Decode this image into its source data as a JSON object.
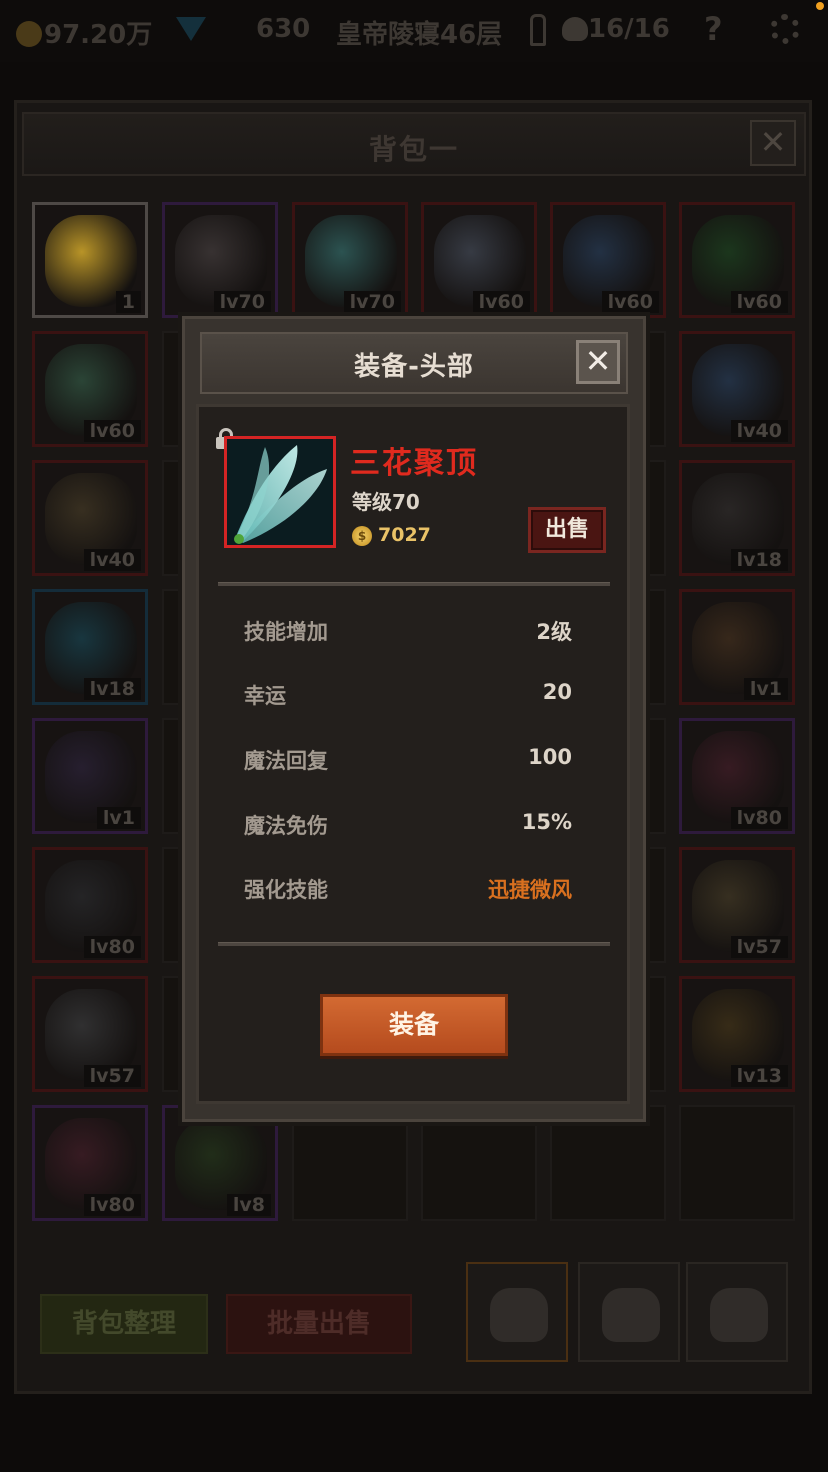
{
  "topbar": {
    "gold": "97.20万",
    "gems": "630",
    "location": "皇帝陵寝46层",
    "keys_progress": "16/16",
    "help": "?"
  },
  "backpack": {
    "title": "背包一",
    "close_symbol": "✕",
    "slots": [
      {
        "level": "1",
        "icon": "cheese-icon",
        "color": "#caa22a"
      },
      {
        "level": "lv70",
        "icon": "pistol-icon",
        "color": "#3b3535"
      },
      {
        "level": "lv70",
        "icon": "feather-blades-icon",
        "color": "#2e5a58"
      },
      {
        "level": "lv60",
        "icon": "double-axe-icon",
        "color": "#3a3f49"
      },
      {
        "level": "lv60",
        "icon": "sword-icon",
        "color": "#243449"
      },
      {
        "level": "lv60",
        "icon": "green-orb-necklace-icon",
        "color": "#1c3a1e"
      },
      {
        "level": "lv60",
        "icon": "green-ring-icon",
        "color": "#2d4a3a"
      },
      {
        "level": "",
        "icon": "",
        "color": ""
      },
      {
        "level": "",
        "icon": "",
        "color": ""
      },
      {
        "level": "",
        "icon": "",
        "color": ""
      },
      {
        "level": "",
        "icon": "",
        "color": ""
      },
      {
        "level": "lv40",
        "icon": "sword-icon",
        "color": "#243449"
      },
      {
        "level": "lv40",
        "icon": "gold-ring-icon",
        "color": "#3b3222"
      },
      {
        "level": "",
        "icon": "",
        "color": ""
      },
      {
        "level": "",
        "icon": "",
        "color": ""
      },
      {
        "level": "",
        "icon": "",
        "color": ""
      },
      {
        "level": "",
        "icon": "",
        "color": ""
      },
      {
        "level": "lv18",
        "icon": "scythe-icon",
        "color": "#2b2827"
      },
      {
        "level": "lv18",
        "icon": "blue-amulet-icon",
        "color": "#183a44"
      },
      {
        "level": "",
        "icon": "",
        "color": ""
      },
      {
        "level": "",
        "icon": "",
        "color": ""
      },
      {
        "level": "",
        "icon": "",
        "color": ""
      },
      {
        "level": "",
        "icon": "",
        "color": ""
      },
      {
        "level": "lv1",
        "icon": "purple-amulet-icon",
        "color": "#3a2a1c"
      },
      {
        "level": "lv1",
        "icon": "dark-armor-icon",
        "color": "#282032"
      },
      {
        "level": "",
        "icon": "",
        "color": ""
      },
      {
        "level": "",
        "icon": "",
        "color": ""
      },
      {
        "level": "",
        "icon": "",
        "color": ""
      },
      {
        "level": "",
        "icon": "",
        "color": ""
      },
      {
        "level": "lv80",
        "icon": "red-boots-icon",
        "color": "#3a1c24"
      },
      {
        "level": "lv80",
        "icon": "plate-armor-icon",
        "color": "#262628"
      },
      {
        "level": "",
        "icon": "",
        "color": ""
      },
      {
        "level": "",
        "icon": "",
        "color": ""
      },
      {
        "level": "",
        "icon": "",
        "color": ""
      },
      {
        "level": "",
        "icon": "",
        "color": ""
      },
      {
        "level": "lv57",
        "icon": "winged-boots-icon",
        "color": "#3a3222"
      },
      {
        "level": "lv57",
        "icon": "silver-armor-icon",
        "color": "#333334"
      },
      {
        "level": "",
        "icon": "",
        "color": ""
      },
      {
        "level": "",
        "icon": "",
        "color": ""
      },
      {
        "level": "",
        "icon": "",
        "color": ""
      },
      {
        "level": "",
        "icon": "",
        "color": ""
      },
      {
        "level": "lv13",
        "icon": "gold-band-icon",
        "color": "#3a2e18"
      },
      {
        "level": "lv80",
        "icon": "red-boots-icon",
        "color": "#3a1c24"
      },
      {
        "level": "lv8",
        "icon": "leaf-wreath-icon",
        "color": "#22301a"
      },
      {
        "level": "",
        "icon": "",
        "color": ""
      },
      {
        "level": "",
        "icon": "",
        "color": ""
      },
      {
        "level": "",
        "icon": "",
        "color": ""
      },
      {
        "level": "",
        "icon": "",
        "color": ""
      }
    ],
    "sort_button": "背包整理",
    "bulk_sell_button": "批量出售"
  },
  "modal": {
    "title": "装备-头部",
    "close_symbol": "✕",
    "item": {
      "name": "三花聚顶",
      "level": "等级70",
      "coin_symbol": "$",
      "price": "7027",
      "name_color": "#e02a1e",
      "icon": "feather-blades-icon"
    },
    "sell_button": "出售",
    "stats": [
      {
        "label": "技能增加",
        "value": "2级"
      },
      {
        "label": "幸运",
        "value": "20"
      },
      {
        "label": "魔法回复",
        "value": "100"
      },
      {
        "label": "魔法免伤",
        "value": "15%"
      },
      {
        "label": "强化技能",
        "value": "迅捷微风"
      }
    ],
    "equip_button": "装备"
  }
}
